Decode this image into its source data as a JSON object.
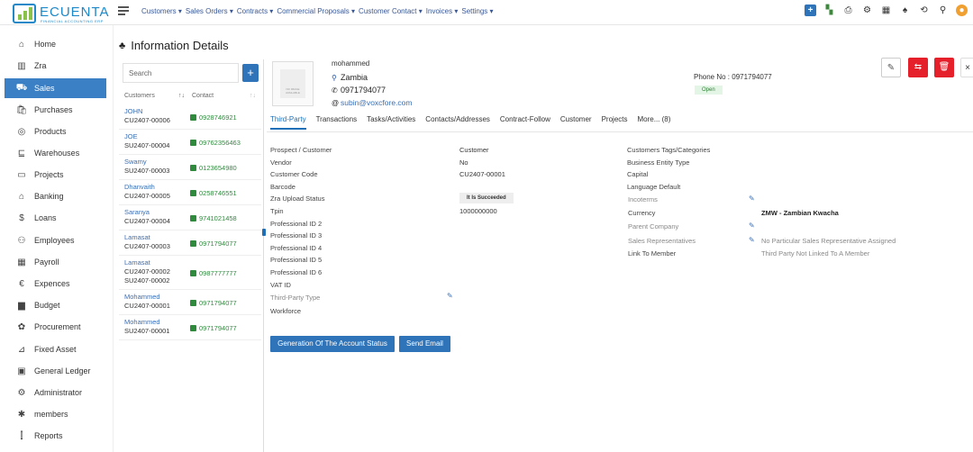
{
  "app": {
    "logo_text": "ECUENTA",
    "logo_tagline": "FINANCIAL ACCOUNTING ERP"
  },
  "topmenu": [
    "Customers ▾",
    "Sales Orders ▾",
    "Contracts ▾",
    "Commercial Proposals ▾",
    "Customer Contact ▾",
    "Invoices ▾",
    "Settings ▾"
  ],
  "topicons": [
    "add-icon",
    "chat-icon",
    "printer-icon",
    "settings-icon",
    "calendar-icon",
    "bell-icon",
    "history-icon",
    "location-icon",
    "user-avatar-icon"
  ],
  "sidebar": {
    "items": [
      {
        "label": "Home",
        "icon": "⌂"
      },
      {
        "label": "Zra",
        "icon": "▥"
      },
      {
        "label": "Sales",
        "icon": "⛟"
      },
      {
        "label": "Purchases",
        "icon": "🛍"
      },
      {
        "label": "Products",
        "icon": "◎"
      },
      {
        "label": "Warehouses",
        "icon": "⊑"
      },
      {
        "label": "Projects",
        "icon": "▭"
      },
      {
        "label": "Banking",
        "icon": "⌂"
      },
      {
        "label": "Loans",
        "icon": "$"
      },
      {
        "label": "Employees",
        "icon": "⚇"
      },
      {
        "label": "Payroll",
        "icon": "▦"
      },
      {
        "label": "Expences",
        "icon": "€"
      },
      {
        "label": "Budget",
        "icon": "▆"
      },
      {
        "label": "Procurement",
        "icon": "✿"
      },
      {
        "label": "Fixed Asset",
        "icon": "⊿"
      },
      {
        "label": "General Ledger",
        "icon": "▣"
      },
      {
        "label": "Administrator",
        "icon": "⚙"
      },
      {
        "label": "members",
        "icon": "✱"
      },
      {
        "label": "Reports",
        "icon": "⫿"
      }
    ]
  },
  "page": {
    "title": "Information Details"
  },
  "list": {
    "search_placeholder": "Search",
    "add_label": "+",
    "col_customers": "Customers",
    "col_contact": "Contact",
    "rows": [
      {
        "name": "JOHN",
        "code": "CU2407-00006",
        "code2": "",
        "phone": "0928746921"
      },
      {
        "name": "JOE",
        "code": "SU2407-00004",
        "code2": "",
        "phone": "09762356463"
      },
      {
        "name": "Swamy",
        "code": "SU2407-00003",
        "code2": "",
        "phone": "0123654980"
      },
      {
        "name": "Dhanvaith",
        "code": "CU2407-00005",
        "code2": "",
        "phone": "0258746551"
      },
      {
        "name": "Saranya",
        "code": "CU2407-00004",
        "code2": "",
        "phone": "9741021458"
      },
      {
        "name": "Lamasat",
        "code": "CU2407-00003",
        "code2": "",
        "phone": "0971794077"
      },
      {
        "name": "Lamasat",
        "code": "CU2407-00002",
        "code2": "SU2407-00002",
        "phone": "0987777777"
      },
      {
        "name": "Mohammed",
        "code": "CU2407-00001",
        "code2": "",
        "phone": "0971794077"
      },
      {
        "name": "Mohammed",
        "code": "SU2407-00001",
        "code2": "",
        "phone": "0971794077"
      }
    ]
  },
  "profile": {
    "image_text": "NO IMAGE AVAILABLE",
    "name": "mohammed",
    "country": "Zambia",
    "phone": "0971794077",
    "email": "subin@voxcfore.com",
    "phone_label": "Phone No : 0971794077",
    "status": "Open"
  },
  "tabs": [
    "Third-Party",
    "Transactions",
    "Tasks/Activities",
    "Contacts/Addresses",
    "Contract-Follow",
    "Customer",
    "Projects",
    "More... (8)"
  ],
  "details": {
    "col1": [
      "Prospect / Customer",
      "Vendor",
      "Customer Code",
      "Barcode",
      "Zra Upload Status",
      "Tpin",
      "Professional ID 2",
      "Professional ID 3",
      "Professional ID 4",
      "Professional ID 5",
      "Professional ID 6",
      "VAT ID",
      "Third-Party Type",
      "Workforce"
    ],
    "col1_values": {
      "prospect": "Customer",
      "vendor": "No",
      "code": "CU2407-00001",
      "zra": "It Is Succeeded",
      "tpin": "1000000000"
    },
    "col3": [
      "Customers Tags/Categories",
      "Business Entity Type",
      "Capital",
      "Language Default"
    ],
    "col3b": [
      "Incoterms",
      "Currency",
      "Parent Company",
      "Sales Representatives",
      "Link To Member"
    ],
    "currency": "ZMW - Zambian Kwacha",
    "sales_rep": "No Particular Sales Representative Assigned",
    "link_member": "Third Party Not Linked To A Member"
  },
  "buttons": {
    "generate": "Generation Of The Account Status",
    "send_email": "Send Email"
  },
  "colors": {
    "accent": "#2f73b8",
    "danger": "#e5202a",
    "sidebar_active": "#3b7fc4"
  }
}
